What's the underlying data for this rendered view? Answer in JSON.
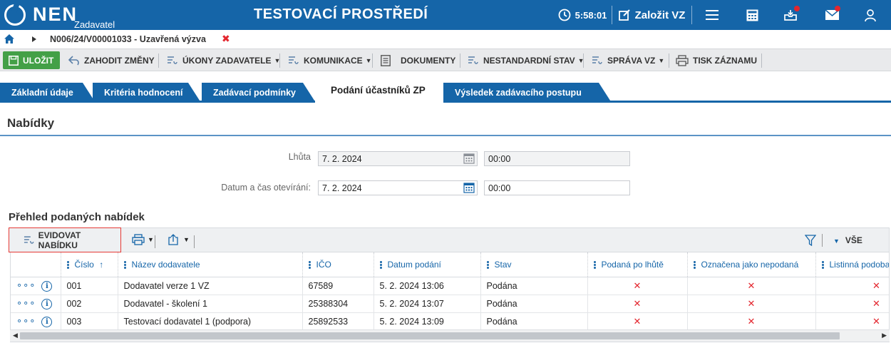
{
  "topbar": {
    "logo_text": "NEN",
    "logo_sub": "Zadavatel",
    "env_title": "TESTOVACÍ PROSTŘEDÍ",
    "clock": "5:58:01",
    "new_vz": "Založit VZ",
    "icons": [
      "clock-icon",
      "edit-icon",
      "hamburger-menu-icon",
      "calculator-icon",
      "inbox-icon",
      "mail-icon",
      "user-icon"
    ],
    "notification_color": "#e3262e",
    "brand_color": "#1565a8"
  },
  "breadcrumb": {
    "text": "N006/24/V00001033 - Uzavřená výzva",
    "close": "✖"
  },
  "toolbar": {
    "save": "ULOŽIT",
    "discard": "ZAHODIT ZMĚNY",
    "actions": "ÚKONY ZADAVATELE",
    "communication": "KOMUNIKACE",
    "documents": "DOKUMENTY",
    "nonstandard": "NESTANDARDNÍ STAV",
    "management": "SPRÁVA VZ",
    "print": "TISK ZÁZNAMU"
  },
  "tabs": [
    {
      "label": "Základní údaje"
    },
    {
      "label": "Kritéria hodnocení"
    },
    {
      "label": "Zadávací podmínky"
    },
    {
      "label": "Podání účastníků ZP"
    },
    {
      "label": "Výsledek zadávacího postupu"
    }
  ],
  "section": {
    "title": "Nabídky"
  },
  "form": {
    "deadline_label": "Lhůta",
    "deadline_date": "7. 2. 2024",
    "deadline_time": "00:00",
    "opening_label": "Datum a čas otevírání:",
    "opening_date": "7. 2. 2024",
    "opening_time": "00:00"
  },
  "grid": {
    "title": "Přehled podaných nabídek",
    "register_button": "EVIDOVAT NABÍDKU",
    "filter_all": "VŠE",
    "columns": {
      "cislo": "Číslo",
      "sort_arrow": "↑",
      "nazev": "Název dodavatele",
      "ico": "IČO",
      "datum": "Datum podání",
      "stav": "Stav",
      "po_lhute": "Podaná po lhůtě",
      "nepodana": "Označena jako nepodaná",
      "listinna": "Listinná podoba"
    },
    "rows": [
      {
        "menu": "∘∘∘",
        "info": "i",
        "cislo": "001",
        "nazev": "Dodavatel verze 1 VZ",
        "ico": "67589",
        "datum": "5. 2. 2024 13:06",
        "stav": "Podána",
        "po_lhute": "✕",
        "nepodana": "✕",
        "listinna": "✕"
      },
      {
        "menu": "∘∘∘",
        "info": "i",
        "cislo": "002",
        "nazev": "Dodavatel - školení 1",
        "ico": "25388304",
        "datum": "5. 2. 2024 13:07",
        "stav": "Podána",
        "po_lhute": "✕",
        "nepodana": "✕",
        "listinna": "✕"
      },
      {
        "menu": "∘∘∘",
        "info": "i",
        "cislo": "003",
        "nazev": "Testovací dodavatel 1 (podpora)",
        "ico": "25892533",
        "datum": "5. 2. 2024 13:09",
        "stav": "Podána",
        "po_lhute": "✕",
        "nepodana": "✕",
        "listinna": "✕"
      }
    ]
  }
}
